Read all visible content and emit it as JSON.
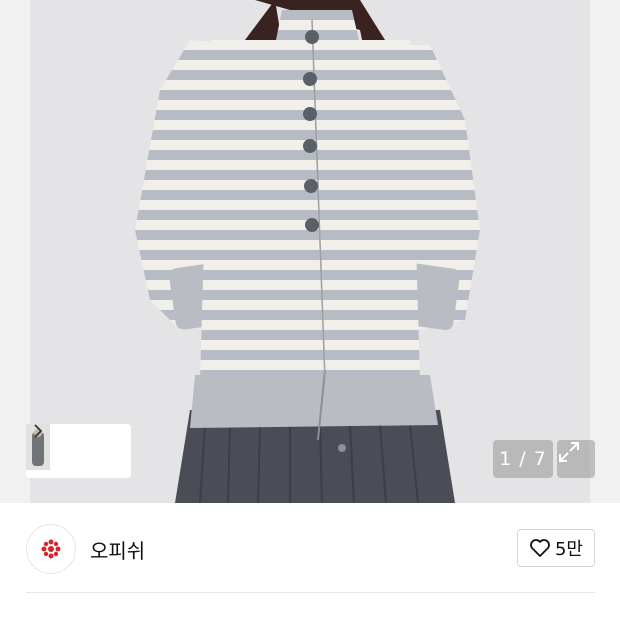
{
  "gallery": {
    "page_counter": "1 / 7",
    "expand_icon": "expand-icon",
    "thumbnail_icon": "chevron-right-icon",
    "photo_description_icon": "product-photo"
  },
  "brand": {
    "name": "오피쉬",
    "logo_icon": "brand-logo-icon",
    "logo_color": "#d6262b"
  },
  "like": {
    "icon": "heart-icon",
    "count": "5만"
  }
}
